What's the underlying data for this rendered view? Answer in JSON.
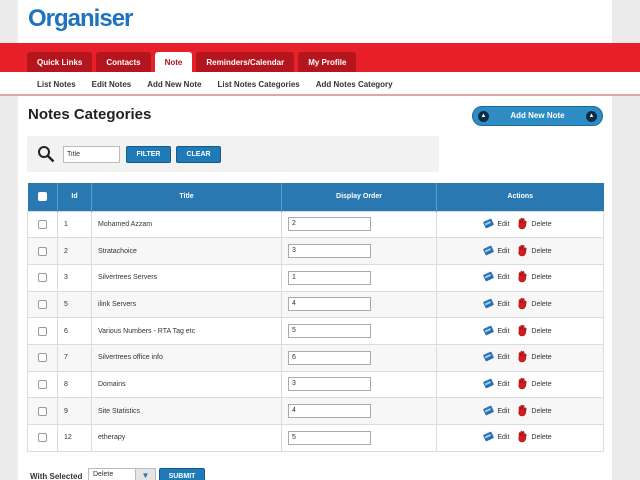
{
  "app": {
    "logo": "Organiser"
  },
  "tabs": [
    {
      "label": "Quick Links",
      "active": false
    },
    {
      "label": "Contacts",
      "active": false
    },
    {
      "label": "Note",
      "active": true
    },
    {
      "label": "Reminders/Calendar",
      "active": false
    },
    {
      "label": "My Profile",
      "active": false
    }
  ],
  "subnav": [
    "List Notes",
    "Edit Notes",
    "Add New Note",
    "List Notes Categories",
    "Add Notes Category"
  ],
  "page": {
    "title": "Notes Categories",
    "add_button_label": "Add New Note"
  },
  "filter": {
    "input_value": "Title",
    "filter_label": "FILTER",
    "clear_label": "CLEAR"
  },
  "table": {
    "headers": {
      "id": "Id",
      "title": "Title",
      "order": "Display Order",
      "actions": "Actions"
    },
    "edit_label": "Edit",
    "delete_label": "Delete",
    "rows": [
      {
        "id": "1",
        "title": "Mohamed Azzam",
        "order": "2"
      },
      {
        "id": "2",
        "title": "Stratachoice",
        "order": "3"
      },
      {
        "id": "3",
        "title": "Silvertrees Servers",
        "order": "1"
      },
      {
        "id": "5",
        "title": "ilink Servers",
        "order": "4"
      },
      {
        "id": "6",
        "title": "Various Numbers - RTA Tag etc",
        "order": "5"
      },
      {
        "id": "7",
        "title": "Silvertrees office info",
        "order": "6"
      },
      {
        "id": "8",
        "title": "Domains",
        "order": "3"
      },
      {
        "id": "9",
        "title": "Site Statistics",
        "order": "4"
      },
      {
        "id": "12",
        "title": "etherapy",
        "order": "5"
      }
    ]
  },
  "bulk": {
    "label": "With Selected",
    "select_value": "Delete",
    "submit_label": "SUBMIT"
  },
  "colors": {
    "brand": "#1e73be",
    "nav_red": "#e8202a",
    "table_header": "#2a78b1"
  }
}
